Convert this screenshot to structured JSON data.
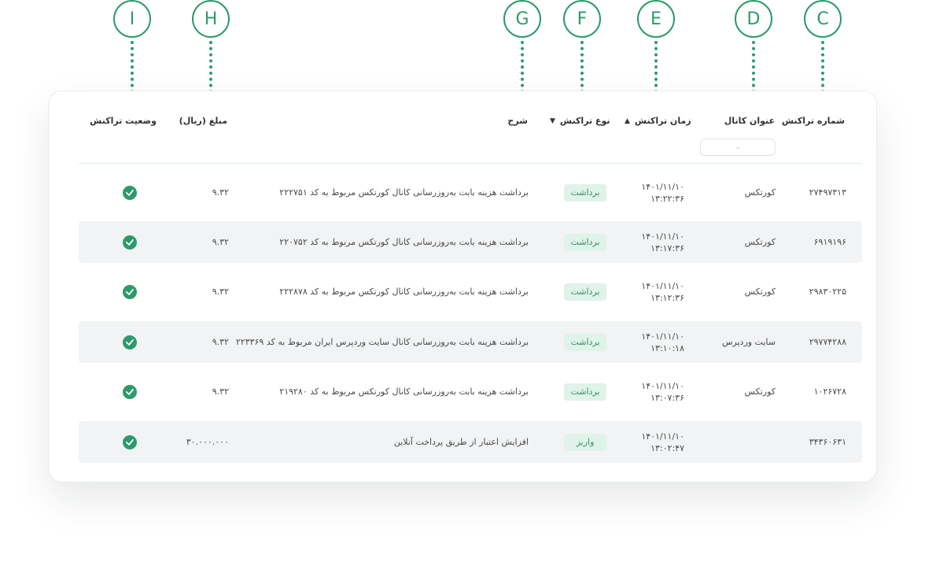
{
  "markers": [
    "I",
    "H",
    "G",
    "F",
    "E",
    "D",
    "C"
  ],
  "headers": {
    "status": "وضعیت تراکنش",
    "amount": "مبلغ (ریال)",
    "description": "شرح",
    "type": "نوع تراکنش",
    "time": "زمان تراکنش",
    "channel": "عنوان کانال",
    "number": "شماره تراکنش"
  },
  "icons": {
    "type_sort": "chevron-down-icon",
    "time_sort": "chevron-up-icon",
    "filter": "chevron-down-icon",
    "status": "check-circle-icon"
  },
  "colors": {
    "accent": "#2e9a6a",
    "pill_bg": "#dff3ea",
    "pill_text": "#3b8e67",
    "row_shade": "#f2f3f4"
  },
  "rows": [
    {
      "number": "۲۷۴۹۷۳۱۳",
      "channel": "کورتکس",
      "date": "۱۴۰۱/۱۱/۱۰",
      "time": "۱۳:۲۲:۳۶",
      "type": "برداشت",
      "description": "برداشت هزینه بابت به‌روزرسانی کانال کورتکس مربوط به کد ۲۲۲۷۵۱",
      "amount": "۹.۳۲"
    },
    {
      "number": "۶۹۱۹۱۹۶",
      "channel": "کورتکس",
      "date": "۱۴۰۱/۱۱/۱۰",
      "time": "۱۳:۱۷:۳۶",
      "type": "برداشت",
      "description": "برداشت هزینه بابت به‌روزرسانی کانال کورتکس مربوط به کد ۲۲۰۷۵۲",
      "amount": "۹.۳۲"
    },
    {
      "number": "۲۹۸۳۰۲۲۵",
      "channel": "کورتکس",
      "date": "۱۴۰۱/۱۱/۱۰",
      "time": "۱۳:۱۲:۳۶",
      "type": "برداشت",
      "description": "برداشت هزینه بابت به‌روزرسانی کانال کورتکس مربوط به کد ۲۲۲۸۷۸",
      "amount": "۹.۳۲"
    },
    {
      "number": "۲۹۷۷۴۲۸۸",
      "channel": "سایت وردپرس",
      "date": "۱۴۰۱/۱۱/۱۰",
      "time": "۱۳:۱۰:۱۸",
      "type": "برداشت",
      "description": "برداشت هزینه بابت به‌روزرسانی کانال سایت وردپرس ایران مربوط به کد ۲۲۳۳۶۹",
      "amount": "۹.۳۲"
    },
    {
      "number": "۱۰۲۶۷۲۸",
      "channel": "کورتکس",
      "date": "۱۴۰۱/۱۱/۱۰",
      "time": "۱۳:۰۷:۳۶",
      "type": "برداشت",
      "description": "برداشت هزینه بابت به‌روزرسانی کانال کورتکس مربوط به کد ۲۱۹۲۸۰",
      "amount": "۹.۳۲"
    },
    {
      "number": "۳۴۳۶۰۶۳۱",
      "channel": "",
      "date": "۱۴۰۱/۱۱/۱۰",
      "time": "۱۳:۰۲:۴۷",
      "type": "واریز",
      "description": "افزایش اعتبار از طریق پرداخت آنلاین",
      "amount": "۳۰.۰۰۰.۰۰۰"
    }
  ]
}
